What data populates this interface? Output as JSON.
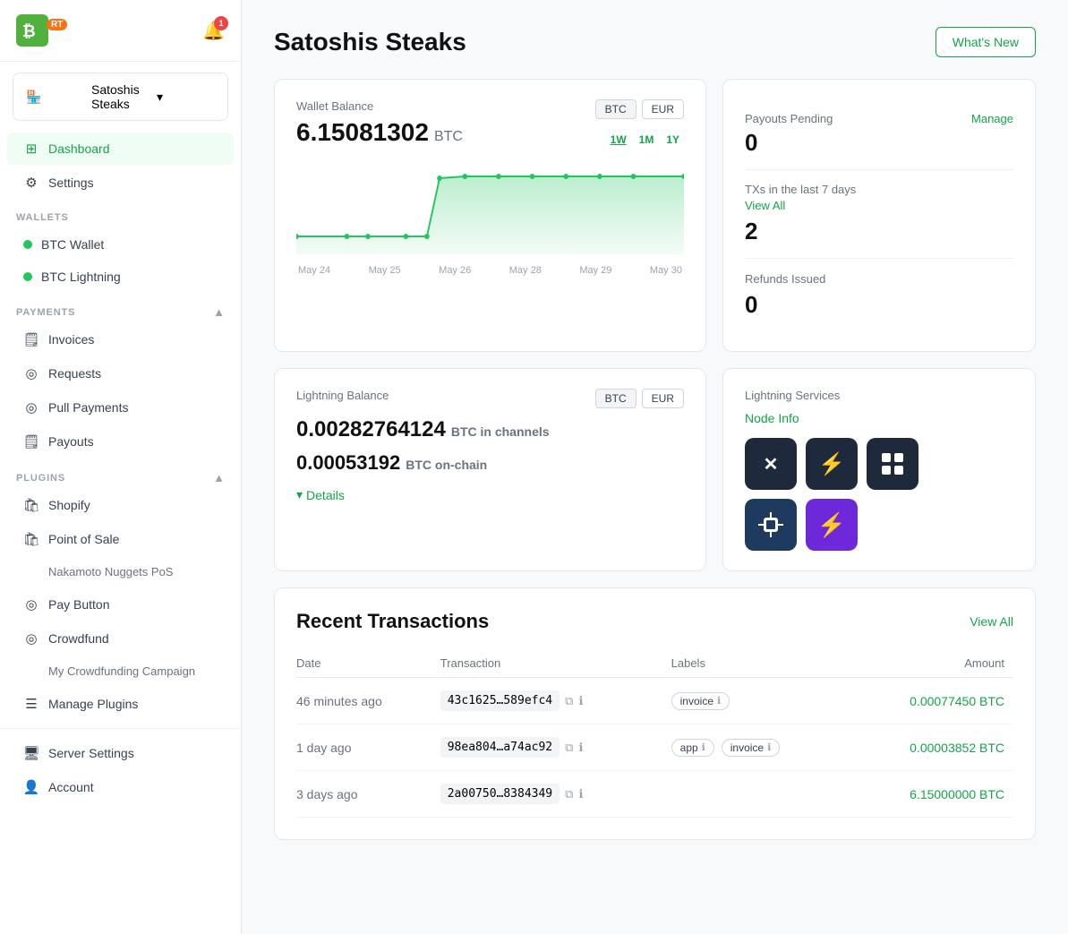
{
  "app": {
    "name": "BTCPay",
    "badge": "RT",
    "notification_count": "1"
  },
  "store_selector": {
    "label": "Satoshis Steaks",
    "icon": "store-icon"
  },
  "sidebar": {
    "nav": [
      {
        "id": "dashboard",
        "label": "Dashboard",
        "icon": "grid",
        "active": true
      },
      {
        "id": "settings",
        "label": "Settings",
        "icon": "gear",
        "active": false
      }
    ],
    "wallets_section": "WALLETS",
    "wallets": [
      {
        "id": "btc-wallet",
        "label": "BTC Wallet"
      },
      {
        "id": "btc-lightning",
        "label": "BTC Lightning"
      }
    ],
    "payments_section": "PAYMENTS",
    "payments": [
      {
        "id": "invoices",
        "label": "Invoices",
        "icon": "doc"
      },
      {
        "id": "requests",
        "label": "Requests",
        "icon": "circle"
      },
      {
        "id": "pull-payments",
        "label": "Pull Payments",
        "icon": "circle"
      },
      {
        "id": "payouts",
        "label": "Payouts",
        "icon": "doc"
      }
    ],
    "plugins_section": "PLUGINS",
    "plugins": [
      {
        "id": "shopify",
        "label": "Shopify",
        "icon": "bag"
      },
      {
        "id": "point-of-sale",
        "label": "Point of Sale",
        "icon": "bag"
      },
      {
        "id": "nakamoto-nuggets",
        "label": "Nakamoto Nuggets PoS",
        "sub": true
      },
      {
        "id": "pay-button",
        "label": "Pay Button",
        "icon": "circle"
      },
      {
        "id": "crowdfund",
        "label": "Crowdfund",
        "icon": "circle"
      },
      {
        "id": "my-crowdfunding",
        "label": "My Crowdfunding Campaign",
        "sub": true
      }
    ],
    "manage_plugins": "Manage Plugins",
    "bottom": [
      {
        "id": "server-settings",
        "label": "Server Settings",
        "icon": "server"
      },
      {
        "id": "account",
        "label": "Account",
        "icon": "person"
      }
    ]
  },
  "header": {
    "title": "Satoshis Steaks",
    "whats_new": "What's New"
  },
  "wallet_balance": {
    "label": "Wallet Balance",
    "amount": "6.15081302",
    "unit": "BTC",
    "currencies": [
      "BTC",
      "EUR"
    ],
    "time_ranges": [
      "1W",
      "1M",
      "1Y"
    ],
    "active_time": "1W",
    "chart_dates": [
      "May 24",
      "May 25",
      "May 26",
      "May 28",
      "May 29",
      "May 30"
    ]
  },
  "right_panel": {
    "payouts_pending": {
      "label": "Payouts Pending",
      "manage_label": "Manage",
      "value": "0"
    },
    "txs": {
      "label": "TXs in the last 7 days",
      "view_all": "View All",
      "value": "2"
    },
    "refunds": {
      "label": "Refunds Issued",
      "value": "0"
    }
  },
  "lightning_balance": {
    "label": "Lightning Balance",
    "currencies": [
      "BTC",
      "EUR"
    ],
    "channels_amount": "0.00282764124",
    "channels_unit": "BTC in channels",
    "onchain_amount": "0.00053192",
    "onchain_unit": "BTC on-chain",
    "details_label": "Details"
  },
  "lightning_services": {
    "label": "Lightning Services",
    "node_info": "Node Info",
    "icons": [
      {
        "id": "cross-lightning",
        "symbol": "✕",
        "style": "dark"
      },
      {
        "id": "bolt-dark",
        "symbol": "⚡",
        "style": "dark"
      },
      {
        "id": "grid-service",
        "symbol": "⊞",
        "style": "dark"
      },
      {
        "id": "chip-service",
        "symbol": "⬡",
        "style": "chip"
      },
      {
        "id": "bolt-purple",
        "symbol": "⚡",
        "style": "lightning"
      }
    ]
  },
  "transactions": {
    "title": "Recent Transactions",
    "view_all": "View All",
    "columns": [
      "Date",
      "Transaction",
      "Labels",
      "Amount"
    ],
    "rows": [
      {
        "date": "46 minutes ago",
        "hash": "43c1625…589efc4",
        "labels": [
          {
            "text": "invoice",
            "icon": "ℹ"
          }
        ],
        "amount": "0.00077450 BTC"
      },
      {
        "date": "1 day ago",
        "hash": "98ea804…a74ac92",
        "labels": [
          {
            "text": "app",
            "icon": "ℹ"
          },
          {
            "text": "invoice",
            "icon": "ℹ"
          }
        ],
        "amount": "0.00003852 BTC"
      },
      {
        "date": "3 days ago",
        "hash": "2a00750…8384349",
        "labels": [],
        "amount": "6.15000000 BTC"
      }
    ]
  }
}
